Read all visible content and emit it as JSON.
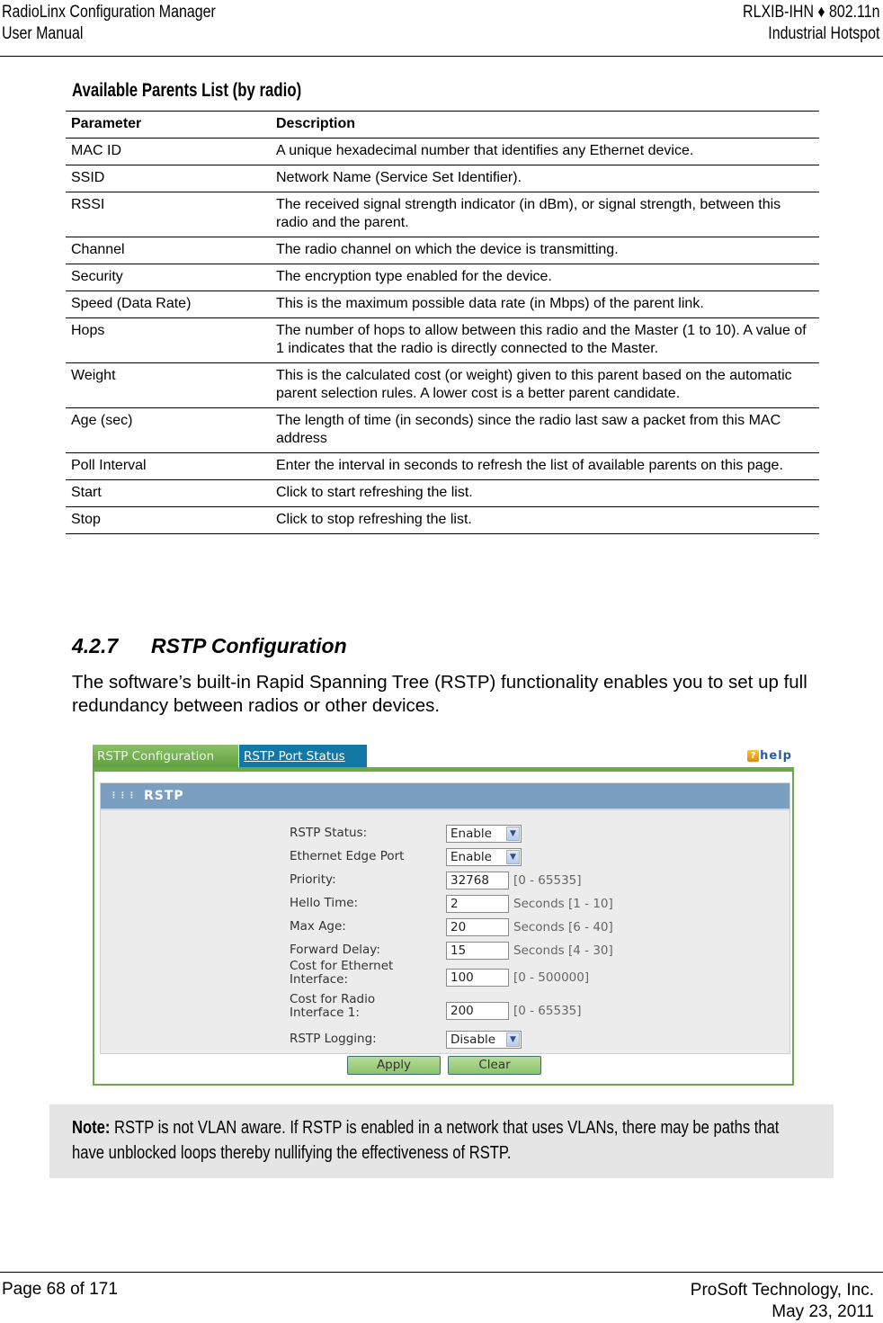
{
  "header": {
    "left_line1": "RadioLinx Configuration Manager",
    "left_line2": "User Manual",
    "right_line1": "RLXIB-IHN ♦ 802.11n",
    "right_line2": "Industrial Hotspot"
  },
  "parents_table": {
    "title": "Available Parents List (by radio)",
    "columns": [
      "Parameter",
      "Description"
    ],
    "rows": [
      {
        "parameter": "MAC ID",
        "description": "A unique hexadecimal number that identifies any Ethernet device."
      },
      {
        "parameter": "SSID",
        "description": "Network Name (Service Set Identifier)."
      },
      {
        "parameter": "RSSI",
        "description": "The received signal strength indicator (in dBm), or signal strength, between this radio and the parent."
      },
      {
        "parameter": "Channel",
        "description": "The radio channel on which the device is transmitting."
      },
      {
        "parameter": "Security",
        "description": "The encryption type enabled for the device."
      },
      {
        "parameter": "Speed (Data Rate)",
        "description": "This is the maximum possible data rate (in Mbps) of the parent link."
      },
      {
        "parameter": "Hops",
        "description": "The number of hops to allow between this radio and the Master (1 to 10). A value of 1 indicates that the radio is directly connected to the Master."
      },
      {
        "parameter": "Weight",
        "description": "This is the calculated cost (or weight) given to this parent based on the automatic parent selection rules. A lower cost is a better parent candidate."
      },
      {
        "parameter": "Age (sec)",
        "description": "The length of time (in seconds) since the radio last saw a packet from this MAC address"
      },
      {
        "parameter": "Poll Interval",
        "description": "Enter the interval in seconds to refresh the list of available parents on this page."
      },
      {
        "parameter": "Start",
        "description": "Click to start refreshing the list."
      },
      {
        "parameter": "Stop",
        "description": "Click to stop refreshing the list."
      }
    ]
  },
  "section": {
    "number": "4.2.7",
    "title": "RSTP Configuration",
    "intro": "The software’s built-in Rapid Spanning Tree (RSTP) functionality enables you to set up full redundancy between radios or other devices."
  },
  "rstp_ui": {
    "tabs": [
      {
        "label": "RSTP Configuration",
        "active": true
      },
      {
        "label": "RSTP Port Status",
        "active": false
      }
    ],
    "help_label": "help",
    "help_icon": "question-icon",
    "panel_title": "RSTP",
    "fields": {
      "rstp_status": {
        "label": "RSTP Status:",
        "value": "Enable"
      },
      "edge_port": {
        "label": "Ethernet Edge Port",
        "value": "Enable"
      },
      "priority": {
        "label": "Priority:",
        "value": "32768",
        "hint": "[0 - 65535]"
      },
      "hello_time": {
        "label": "Hello Time:",
        "value": "2",
        "hint": "Seconds [1 - 10]"
      },
      "max_age": {
        "label": "Max Age:",
        "value": "20",
        "hint": "Seconds [6 - 40]"
      },
      "forward_delay": {
        "label": "Forward Delay:",
        "value": "15",
        "hint": "Seconds [4 - 30]"
      },
      "cost_ethernet": {
        "label_line1": "Cost for Ethernet",
        "label_line2": "Interface:",
        "value": "100",
        "hint": "[0 - 500000]"
      },
      "cost_radio": {
        "label_line1": "Cost for Radio",
        "label_line2": "Interface 1:",
        "value": "200",
        "hint": "[0 - 65535]"
      },
      "rstp_logging": {
        "label": "RSTP Logging:",
        "value": "Disable"
      }
    },
    "apply_label": "Apply",
    "clear_label": "Clear",
    "dropdown_arrow": "⌄"
  },
  "note": {
    "prefix": "Note:",
    "text": " RSTP is not VLAN aware. If RSTP is enabled in a network that uses VLANs, there may be paths that have unblocked loops thereby nullifying the effectiveness of RSTP."
  },
  "footer": {
    "page": "Page 68 of 171",
    "company": "ProSoft Technology, Inc.",
    "date": "May 23, 2011"
  }
}
